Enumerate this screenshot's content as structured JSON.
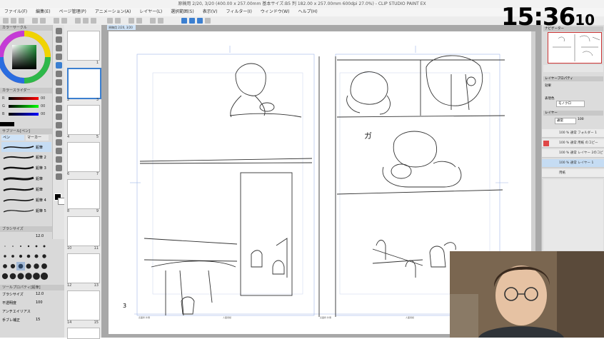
{
  "window": {
    "title": "原稿用 2/20, 3/20 (400.00 x 257.00mm 基本サイズ:B5 判 182.00 x 257.00mm 600dpi 27.0%) - CLIP STUDIO PAINT EX"
  },
  "menu": [
    "ファイル(F)",
    "編集(E)",
    "ページ管理(P)",
    "アニメーション(A)",
    "レイヤー(L)",
    "選択範囲(S)",
    "表示(V)",
    "フィルター(I)",
    "ウィンドウ(W)",
    "ヘルプ(H)"
  ],
  "document_tab": "原稿用 2/20, 3/20",
  "left_panel": {
    "color_wheel_header": "カラーサークル",
    "color_slider_header": "カラースライダー",
    "rgb": [
      {
        "label": "R",
        "value": "00"
      },
      {
        "label": "G",
        "value": "00"
      },
      {
        "label": "B",
        "value": "00"
      }
    ],
    "subtool_header": "サブツール[ペン]",
    "subtool_tabs": [
      "ペン",
      "マーカー"
    ],
    "brushes": [
      "鉛筆",
      "鉛筆 2",
      "鉛筆 3",
      "鉛筆",
      "鉛筆",
      "鉛筆 4",
      "鉛筆 5"
    ],
    "brush_size_header": "ブラシサイズ",
    "brush_size_value": "12.0",
    "brush_sizes": [
      "0.7",
      "1",
      "1.5",
      "2",
      "2.5",
      "3",
      "4",
      "5",
      "6",
      "7",
      "8",
      "10",
      "12",
      "15",
      "17",
      "20",
      "25",
      "30",
      "40",
      "50",
      "60",
      "70",
      "80",
      "100"
    ],
    "tool_property_header": "ツールプロパティ[鉛筆]",
    "properties": [
      {
        "label": "ブラシサイズ",
        "value": "12.0"
      },
      {
        "label": "不透明度",
        "value": "100"
      },
      {
        "label": "アンチエイリアス",
        "value": ""
      },
      {
        "label": "手ブレ補正",
        "value": "15"
      }
    ]
  },
  "page_list": [
    {
      "left": "",
      "right": "1"
    },
    {
      "left": "2",
      "right": "3"
    },
    {
      "left": "4",
      "right": "5"
    },
    {
      "left": "6",
      "right": "7"
    },
    {
      "left": "8",
      "right": "9"
    },
    {
      "left": "10",
      "right": "11"
    },
    {
      "left": "12",
      "right": "13"
    },
    {
      "left": "14",
      "right": "15"
    },
    {
      "left": "16",
      "right": "17"
    }
  ],
  "canvas": {
    "page_number": "3",
    "footer_labels": [
      "表面枠 外側",
      "人面用紙",
      "表面枠 外側",
      "人面用紙"
    ],
    "sketch_text": "ガ"
  },
  "right_panel": {
    "navigator_header": "ナビゲーター",
    "layer_property_header": "レイヤープロパティ",
    "effect_label": "効果",
    "expression_color_label": "表現色",
    "expression_color_value": "モノクロ",
    "layers_header": "レイヤー",
    "blend_mode": "通常",
    "opacity": "100",
    "layers": [
      {
        "name": "100 % 通常 フォルダー 1",
        "selected": false
      },
      {
        "name": "100 % 通常 用紙 のコピー",
        "selected": false
      },
      {
        "name": "100 % 通常 レイヤー 2のコピー",
        "selected": false
      },
      {
        "name": "100 % 通常 レイヤー 1",
        "selected": true
      },
      {
        "name": "用紙",
        "selected": false
      }
    ]
  },
  "overlay_clock": {
    "hours_minutes": "15:36",
    "seconds": "10"
  }
}
